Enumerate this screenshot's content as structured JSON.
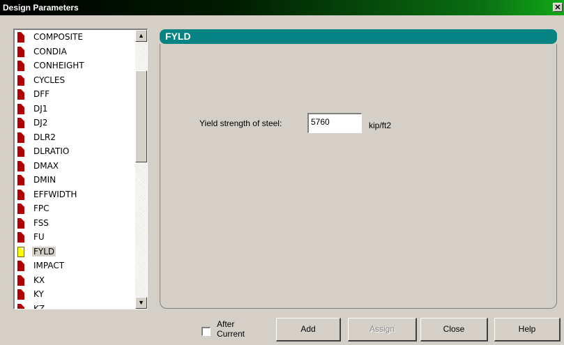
{
  "window": {
    "title": "Design Parameters",
    "close_glyph": "✕"
  },
  "parameters": {
    "items": [
      {
        "label": "COMPOSITE",
        "selected": false
      },
      {
        "label": "CONDIA",
        "selected": false
      },
      {
        "label": "CONHEIGHT",
        "selected": false
      },
      {
        "label": "CYCLES",
        "selected": false
      },
      {
        "label": "DFF",
        "selected": false
      },
      {
        "label": "DJ1",
        "selected": false
      },
      {
        "label": "DJ2",
        "selected": false
      },
      {
        "label": "DLR2",
        "selected": false
      },
      {
        "label": "DLRATIO",
        "selected": false
      },
      {
        "label": "DMAX",
        "selected": false
      },
      {
        "label": "DMIN",
        "selected": false
      },
      {
        "label": "EFFWIDTH",
        "selected": false
      },
      {
        "label": "FPC",
        "selected": false
      },
      {
        "label": "FSS",
        "selected": false
      },
      {
        "label": "FU",
        "selected": false
      },
      {
        "label": "FYLD",
        "selected": true
      },
      {
        "label": "IMPACT",
        "selected": false
      },
      {
        "label": "KX",
        "selected": false
      },
      {
        "label": "KY",
        "selected": false
      },
      {
        "label": "KZ",
        "selected": false
      }
    ]
  },
  "detail": {
    "header": "FYLD",
    "field_label": "Yield strength of steel:",
    "field_value": "5760",
    "unit": "kip/ft2"
  },
  "footer": {
    "after_current_label": "After Current",
    "after_current_checked": false,
    "add_label": "Add",
    "assign_label": "Assign",
    "close_label": "Close",
    "help_label": "Help"
  }
}
